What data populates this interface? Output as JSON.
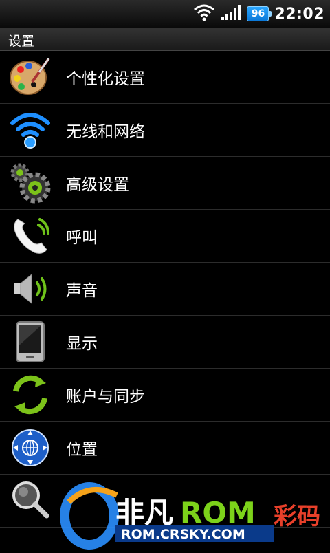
{
  "status_bar": {
    "time": "22:02",
    "battery_level": "96",
    "icons": [
      "wifi-icon",
      "signal-icon",
      "battery-icon"
    ]
  },
  "title": "设置",
  "items": [
    {
      "label": "个性化设置",
      "icon": "palette-icon"
    },
    {
      "label": "无线和网络",
      "icon": "wifi-icon"
    },
    {
      "label": "高级设置",
      "icon": "gears-icon"
    },
    {
      "label": "呼叫",
      "icon": "phone-icon"
    },
    {
      "label": "声音",
      "icon": "speaker-icon"
    },
    {
      "label": "显示",
      "icon": "display-icon"
    },
    {
      "label": "账户与同步",
      "icon": "sync-icon"
    },
    {
      "label": "位置",
      "icon": "location-icon"
    },
    {
      "label": "",
      "icon": "search-icon"
    }
  ],
  "watermark": {
    "brand": "非凡ROM",
    "brand_suffix": "彩码",
    "url": "ROM.CRSKY.COM"
  },
  "colors": {
    "accent_blue": "#1e8fff",
    "sync_green": "#7cc21a"
  }
}
